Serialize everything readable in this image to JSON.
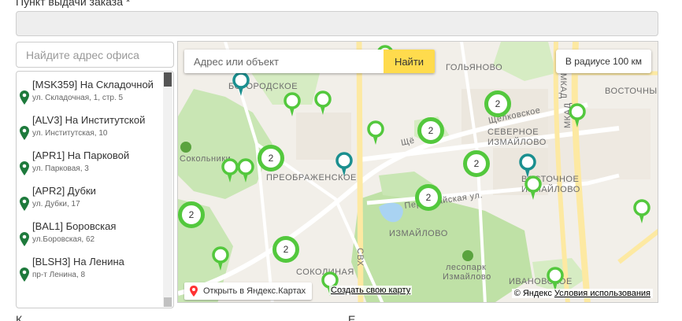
{
  "form": {
    "pickup_label": "Пункт выдачи заказа *",
    "office_search_placeholder": "Найдите адрес офиса",
    "bottom_left_label": "К",
    "bottom_right_label": "E"
  },
  "offices": [
    {
      "name": "[MSK359] На Складочной",
      "address": "ул. Складочная, 1, стр. 5"
    },
    {
      "name": "[ALV3] На Институтской",
      "address": "ул. Институтская, 10"
    },
    {
      "name": "[APR1] На Парковой",
      "address": "ул. Парковая, 3"
    },
    {
      "name": "[APR2] Дубки",
      "address": "ул. Дубки, 17"
    },
    {
      "name": "[BAL1] Боровская",
      "address": "ул.Боровская, 62"
    },
    {
      "name": "[BLSH3] На Ленина",
      "address": "пр-т Ленина, 8"
    }
  ],
  "map": {
    "search_placeholder": "Адрес или объект",
    "find_button": "Найти",
    "radius_button": "В радиусе 100 км",
    "open_in_yandex": "Открыть в Яндекс.Картах",
    "create_map": "Создать свою карту",
    "copyright": "© Яндекс",
    "terms": "Условия использования",
    "cluster_count": "2",
    "labels": {
      "golyanovo": "ГОЛЬЯНОВО",
      "vostochny": "ВОСТОЧНЫЙ",
      "bogorodskoe": "БОГОРОДСКОЕ",
      "schelkovskoe": "Щёлковское",
      "severnoe_izmailovo": "СЕВЕРНОЕ",
      "severnoe_izmailovo2": "ИЗМАЙЛОВО",
      "sokolniki": "Сокольники",
      "preobrazhenskoe": "ПРЕОБРАЖЕНСКОЕ",
      "vostochnoe_izmailovo": "ВОСТОЧНОЕ",
      "vostochnoe_izmailovo2": "ИЗМАЙЛОВО",
      "mkad": "МКАД",
      "pervomayskaya": "Первомайская ул.",
      "izmailovo": "ИЗМАЙЛОВО",
      "lesopark": "лесопарк",
      "lesopark2": "Измайлово",
      "ivanovskoe": "ИВАНОВСКОЕ",
      "sokolnaya": "СОКОЛИНАЯ",
      "svh": "СВХ",
      "sh": "Щё"
    },
    "colors": {
      "accent_green": "#53c83d",
      "teal_pin": "#1a8f8f",
      "find_yellow": "#ffdb4d"
    }
  }
}
